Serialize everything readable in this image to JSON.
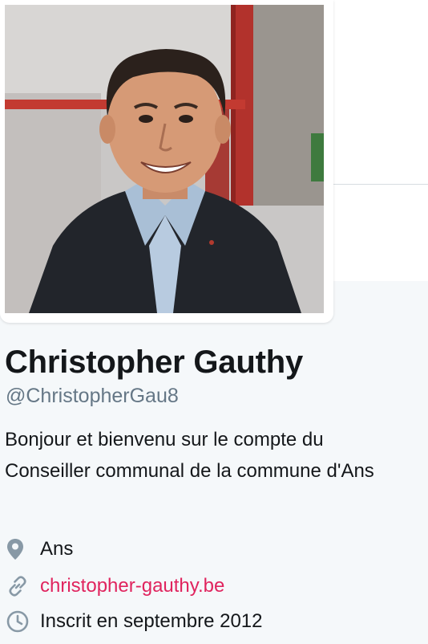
{
  "profile": {
    "name": "Christopher Gauthy",
    "handle": "@ChristopherGau8",
    "bio": "Bonjour et bienvenu sur le compte du Conseiller communal de la commune d'Ans",
    "location": "Ans",
    "website": "christopher-gauthy.be",
    "joined": "Inscrit en septembre 2012"
  },
  "icons": {
    "location": "map-pin-icon",
    "website": "link-icon",
    "joined": "clock-icon"
  },
  "colors": {
    "link": "#e0245e",
    "secondary_text": "#657786",
    "primary_text": "#14171a",
    "panel_background": "#f5f8fa"
  }
}
